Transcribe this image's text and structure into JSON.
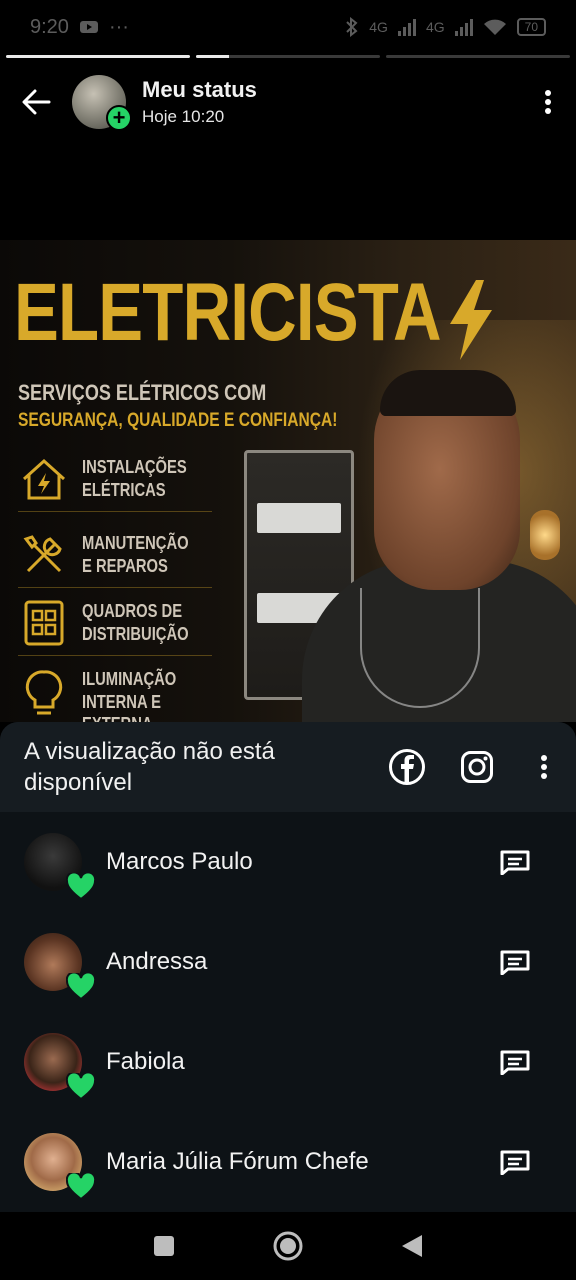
{
  "status_bar": {
    "time": "9:20",
    "more": "···",
    "network1": "4G",
    "network2": "4G",
    "battery": "70"
  },
  "story": {
    "progress": [
      1.0,
      0.18,
      0.0
    ],
    "owner": "Meu status",
    "time": "Hoje 10:20"
  },
  "poster": {
    "title": "ELETRICISTA",
    "subtitle": "SERVIÇOS ELÉTRICOS COM",
    "tagline": "SEGURANÇA, QUALIDADE E CONFIANÇA!",
    "services": [
      {
        "line1": "INSTALAÇÕES",
        "line2": "ELÉTRICAS",
        "icon": "house-bolt-icon"
      },
      {
        "line1": "MANUTENÇÃO",
        "line2": "E REPAROS",
        "icon": "tools-icon"
      },
      {
        "line1": "QUADROS DE",
        "line2": "DISTRIBUIÇÃO",
        "icon": "grid-panel-icon"
      },
      {
        "line1": "ILUMINAÇÃO",
        "line2": "INTERNA E",
        "line3": "EXTERNA",
        "icon": "lightbulb-icon"
      }
    ],
    "accent": "#d8a92a"
  },
  "sheet": {
    "title": "A visualização não está disponível",
    "icons": [
      "facebook-icon",
      "instagram-icon",
      "more-vertical-icon"
    ]
  },
  "viewers": [
    {
      "name": "Marcos Paulo",
      "reaction": "green-heart"
    },
    {
      "name": "Andressa",
      "reaction": "green-heart"
    },
    {
      "name": "Fabiola",
      "reaction": "green-heart"
    },
    {
      "name": "Maria Júlia Fórum Chefe",
      "reaction": "green-heart"
    }
  ],
  "colors": {
    "whatsapp_green": "#25d366",
    "sheet_bg": "#0d1216",
    "sheet_header_bg": "#161c21"
  }
}
